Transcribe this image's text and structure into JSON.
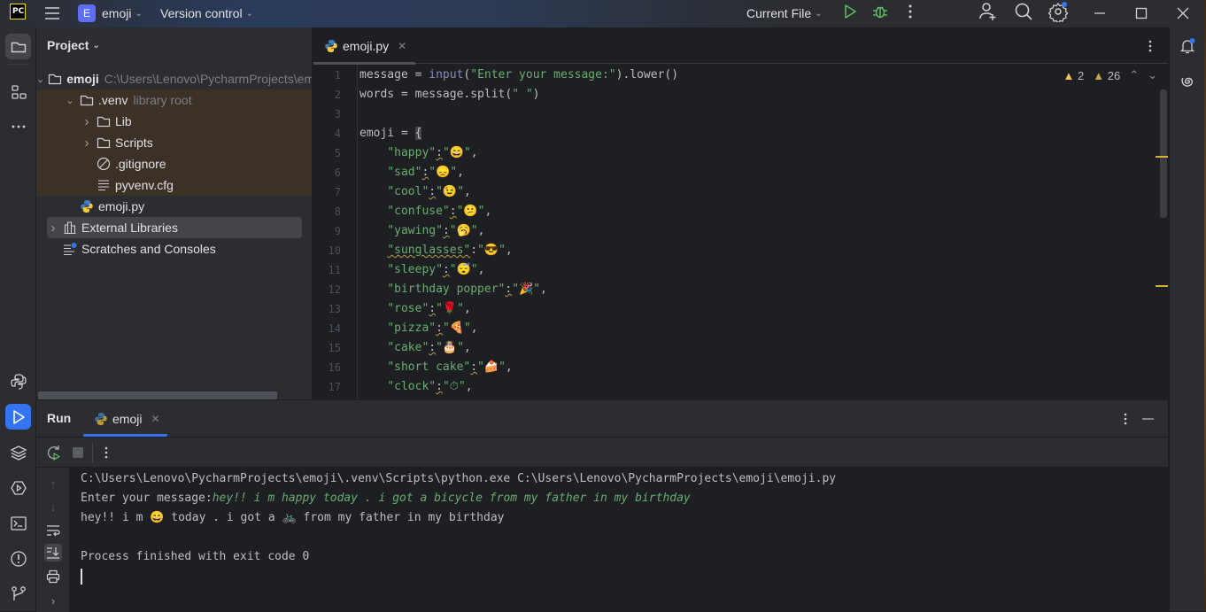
{
  "titlebar": {
    "app_logo": "PC",
    "menu_icon": "hamburger-menu-icon",
    "project_badge": "E",
    "project_name": "emoji",
    "vcs_label": "Version control",
    "run_config": "Current File",
    "icons": [
      "run-icon",
      "debug-icon",
      "more-icon",
      "add-user-icon",
      "search-icon",
      "settings-icon",
      "minimize-icon",
      "maximize-icon",
      "close-icon"
    ]
  },
  "left_toolbar": {
    "icons": [
      "project-icon",
      "structure-icon",
      "more-icon",
      "python-console-icon",
      "run-icon",
      "layers-icon",
      "services-icon",
      "terminal-icon",
      "problems-icon",
      "git-icon"
    ]
  },
  "project_panel": {
    "title": "Project",
    "tree": [
      {
        "label": "emoji",
        "hint": "C:\\Users\\Lenovo\\PycharmProjects\\emoji",
        "icon": "folder-icon",
        "expanded": true,
        "level": 0
      },
      {
        "label": ".venv",
        "hint": "library root",
        "icon": "folder-icon",
        "expanded": true,
        "level": 1
      },
      {
        "label": "Lib",
        "hint": "",
        "icon": "folder-icon",
        "expanded": false,
        "level": 2
      },
      {
        "label": "Scripts",
        "hint": "",
        "icon": "folder-icon",
        "expanded": false,
        "level": 2
      },
      {
        "label": ".gitignore",
        "hint": "",
        "icon": "ignore-file-icon",
        "level": 2
      },
      {
        "label": "pyvenv.cfg",
        "hint": "",
        "icon": "text-file-icon",
        "level": 2
      },
      {
        "label": "emoji.py",
        "hint": "",
        "icon": "python-file-icon",
        "level": 1
      },
      {
        "label": "External Libraries",
        "hint": "",
        "icon": "library-icon",
        "expanded": false,
        "level": 0
      },
      {
        "label": "Scratches and Consoles",
        "hint": "",
        "icon": "scratches-icon",
        "level": 0
      }
    ]
  },
  "editor": {
    "tab_label": "emoji.py",
    "inspections": {
      "warnings": "2",
      "weak_warnings": "26"
    },
    "lines": [
      {
        "n": "1",
        "parts": [
          [
            "",
            "message = "
          ],
          [
            "fn",
            "input"
          ],
          [
            "",
            "("
          ],
          [
            "str",
            "\"Enter your message:\""
          ],
          [
            "",
            ").lower()"
          ]
        ]
      },
      {
        "n": "2",
        "parts": [
          [
            "",
            "words = message.split("
          ],
          [
            "str",
            "\" \""
          ],
          [
            "",
            ")"
          ]
        ]
      },
      {
        "n": "3",
        "parts": []
      },
      {
        "n": "4",
        "parts": [
          [
            "",
            "emoji = "
          ],
          [
            "brace",
            "{"
          ]
        ]
      },
      {
        "n": "5",
        "parts": [
          [
            "",
            "    "
          ],
          [
            "str",
            "\"happy\""
          ],
          [
            "sq",
            ":"
          ],
          [
            "str",
            "\"😄\""
          ],
          [
            "",
            ","
          ]
        ]
      },
      {
        "n": "6",
        "parts": [
          [
            "",
            "    "
          ],
          [
            "str",
            "\"sad\""
          ],
          [
            "sq",
            ":"
          ],
          [
            "str",
            "\"😞\""
          ],
          [
            "",
            ","
          ]
        ]
      },
      {
        "n": "7",
        "parts": [
          [
            "",
            "    "
          ],
          [
            "str",
            "\"cool\""
          ],
          [
            "sq",
            ":"
          ],
          [
            "str",
            "\"😉\""
          ],
          [
            "",
            ","
          ]
        ]
      },
      {
        "n": "8",
        "parts": [
          [
            "",
            "    "
          ],
          [
            "str",
            "\"confuse\""
          ],
          [
            "sq",
            ":"
          ],
          [
            "str",
            "\"😕\""
          ],
          [
            "",
            ","
          ]
        ]
      },
      {
        "n": "9",
        "parts": [
          [
            "",
            "    "
          ],
          [
            "str",
            "\"yawing\""
          ],
          [
            "sq",
            ":"
          ],
          [
            "str",
            "\"🥱\""
          ],
          [
            "",
            ","
          ]
        ]
      },
      {
        "n": "10",
        "parts": [
          [
            "",
            "    "
          ],
          [
            "strsq",
            "\"sunglasses\""
          ],
          [
            "",
            ":"
          ],
          [
            "str",
            "\"😎\""
          ],
          [
            "",
            ","
          ]
        ]
      },
      {
        "n": "11",
        "parts": [
          [
            "",
            "    "
          ],
          [
            "str",
            "\"sleepy\""
          ],
          [
            "sq",
            ":"
          ],
          [
            "str",
            "\"😴\""
          ],
          [
            "",
            ","
          ]
        ]
      },
      {
        "n": "12",
        "parts": [
          [
            "",
            "    "
          ],
          [
            "str",
            "\"birthday popper\""
          ],
          [
            "sq",
            ":"
          ],
          [
            "str",
            "\"🎉\""
          ],
          [
            "",
            ","
          ]
        ]
      },
      {
        "n": "13",
        "parts": [
          [
            "",
            "    "
          ],
          [
            "str",
            "\"rose\""
          ],
          [
            "sq",
            ":"
          ],
          [
            "str",
            "\"🌹\""
          ],
          [
            "",
            ","
          ]
        ]
      },
      {
        "n": "14",
        "parts": [
          [
            "",
            "    "
          ],
          [
            "str",
            "\"pizza\""
          ],
          [
            "sq",
            ":"
          ],
          [
            "str",
            "\"🍕\""
          ],
          [
            "",
            ","
          ]
        ]
      },
      {
        "n": "15",
        "parts": [
          [
            "",
            "    "
          ],
          [
            "str",
            "\"cake\""
          ],
          [
            "sq",
            ":"
          ],
          [
            "str",
            "\"🎂\""
          ],
          [
            "",
            ","
          ]
        ]
      },
      {
        "n": "16",
        "parts": [
          [
            "",
            "    "
          ],
          [
            "str",
            "\"short cake\""
          ],
          [
            "sq",
            ":"
          ],
          [
            "str",
            "\"🍰\""
          ],
          [
            "",
            ","
          ]
        ]
      },
      {
        "n": "17",
        "parts": [
          [
            "",
            "    "
          ],
          [
            "str",
            "\"clock\""
          ],
          [
            "sq",
            ":"
          ],
          [
            "str",
            "\"⏱\""
          ],
          [
            "",
            ","
          ]
        ]
      }
    ]
  },
  "run_panel": {
    "title": "Run",
    "tab_label": "emoji",
    "console": {
      "command": "C:\\Users\\Lenovo\\PycharmProjects\\emoji\\.venv\\Scripts\\python.exe C:\\Users\\Lenovo\\PycharmProjects\\emoji\\emoji.py",
      "prompt": "Enter your message:",
      "user_input": "hey!! i m happy today . i got a bicycle from my father in my birthday",
      "output": "hey!! i m 😄 today . i got a 🚲 from my father in my birthday",
      "exit_message": "Process finished with exit code 0"
    }
  },
  "colors": {
    "accent": "#3574f0",
    "string": "#6aab73",
    "warning": "#f2c55c",
    "venv_highlight": "#3c3126"
  }
}
